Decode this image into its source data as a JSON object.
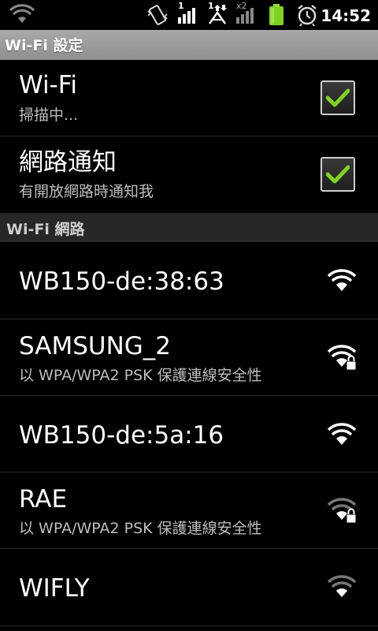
{
  "status_bar": {
    "time": "14:52",
    "icons": [
      "wifi-icon",
      "vibrate-icon",
      "signal-sim1-icon",
      "data-transfer-icon",
      "signal-sim2-icon",
      "battery-icon",
      "alarm-icon"
    ],
    "sim1_label": "1",
    "sim2_label": "x2",
    "data_label": "1"
  },
  "title_bar": {
    "title": "Wi-Fi 設定"
  },
  "settings": [
    {
      "title": "Wi-Fi",
      "summary": "掃描中...",
      "checked": true
    },
    {
      "title": "網路通知",
      "summary": "有開放網路時通知我",
      "checked": true
    }
  ],
  "section_header": "Wi-Fi 網路",
  "networks": [
    {
      "ssid": "WB150-de:38:63",
      "summary": "",
      "secured": false,
      "signal": "strong"
    },
    {
      "ssid": "SAMSUNG_2",
      "summary": "以 WPA/WPA2 PSK 保護連線安全性",
      "secured": true,
      "signal": "strong"
    },
    {
      "ssid": "WB150-de:5a:16",
      "summary": "",
      "secured": false,
      "signal": "strong"
    },
    {
      "ssid": "RAE",
      "summary": "以 WPA/WPA2 PSK 保護連線安全性",
      "secured": true,
      "signal": "weak"
    },
    {
      "ssid": "WIFLY",
      "summary": "",
      "secured": false,
      "signal": "weak"
    }
  ],
  "colors": {
    "check_green": "#7ed321",
    "title_bar": "#9a9a9a",
    "section_bg": "#272727",
    "summary_text": "#bdbdbd"
  }
}
